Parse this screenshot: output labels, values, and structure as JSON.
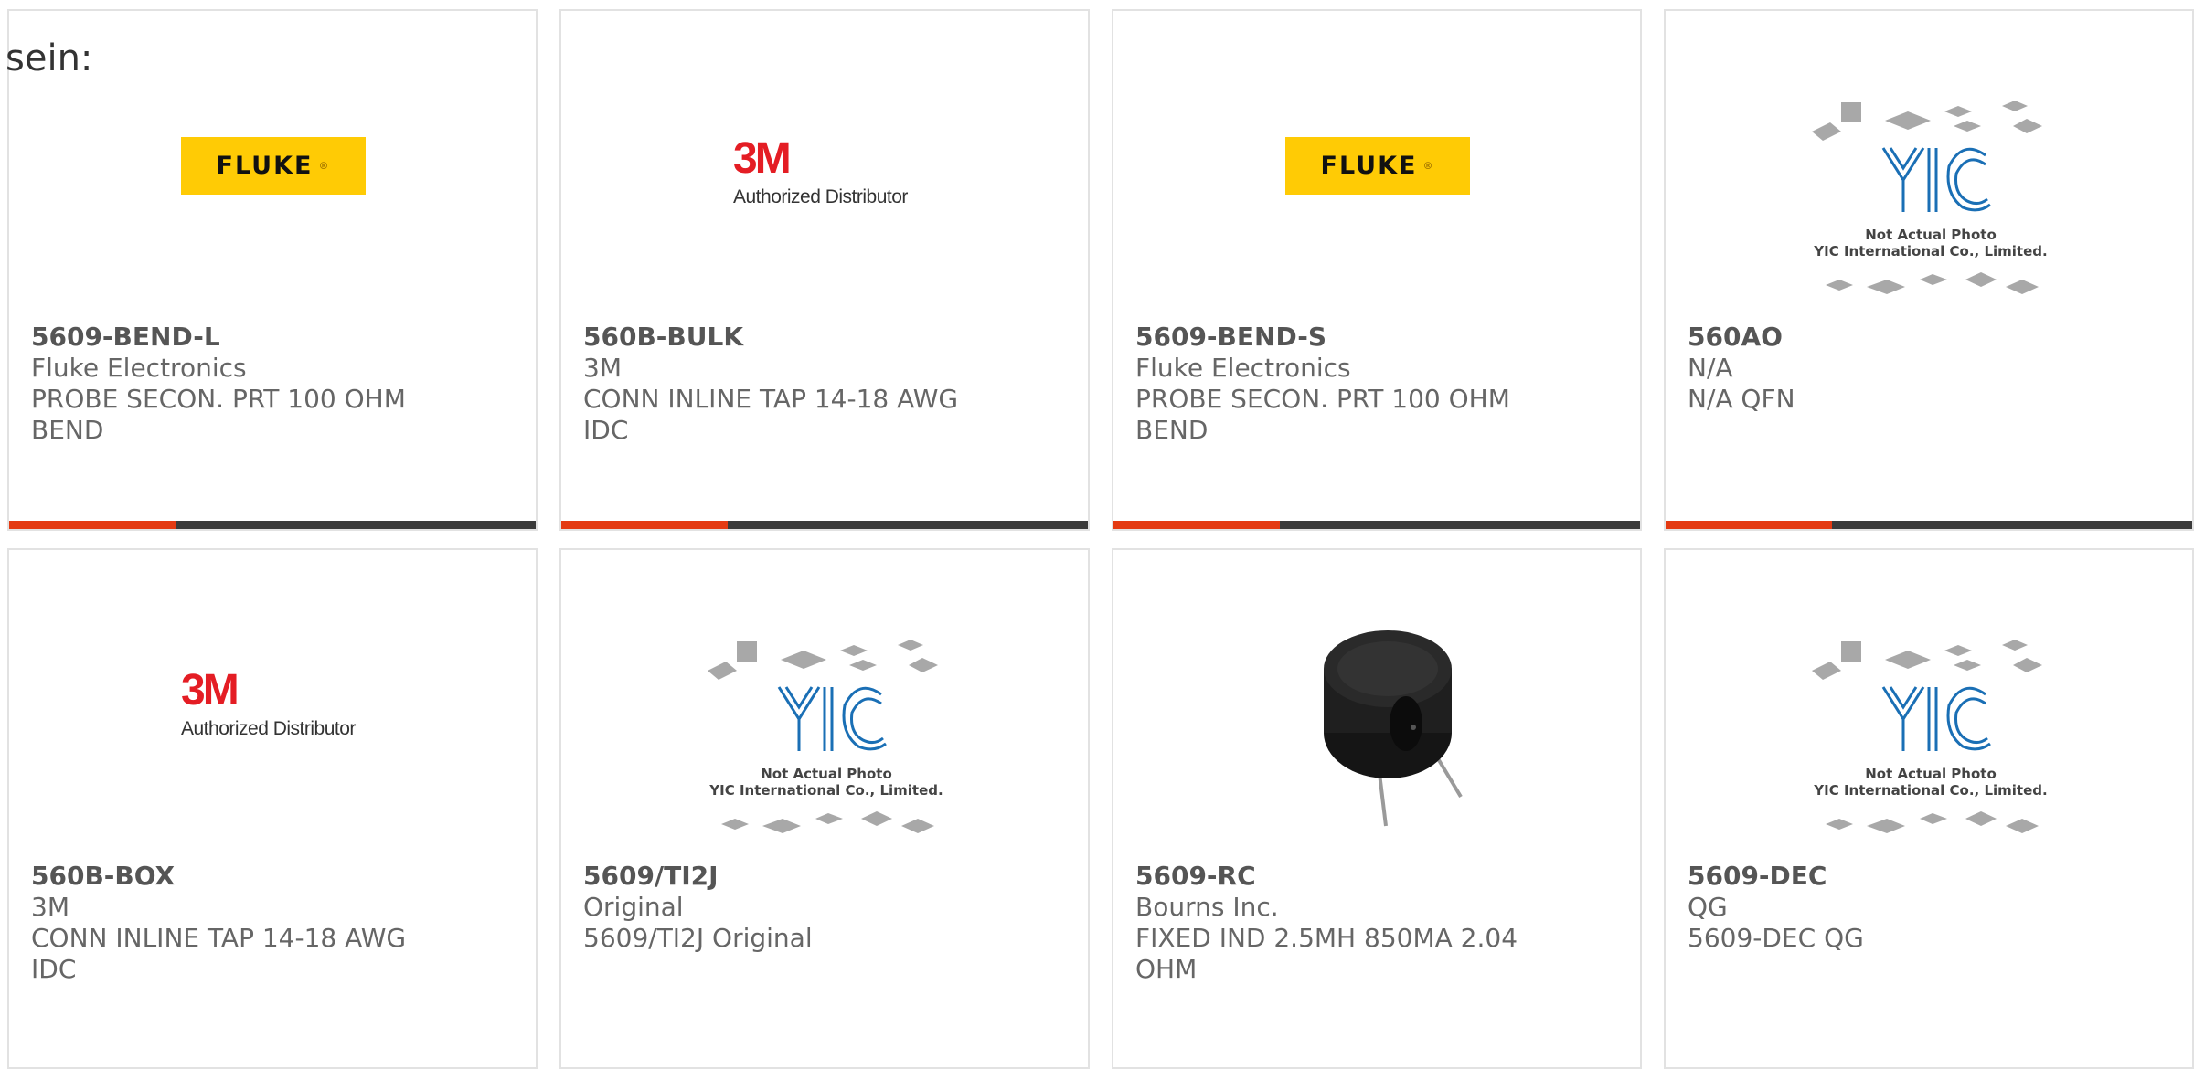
{
  "intro_text": "sein:",
  "products": [
    {
      "logo": "fluke",
      "logo_text": "FLUKE",
      "part_number": "5609-BEND-L",
      "manufacturer": "Fluke Electronics",
      "description": "PROBE SECON. PRT 100 OHM BEND"
    },
    {
      "logo": "3m",
      "logo_text": "3M",
      "logo_subtext": "Authorized Distributor",
      "part_number": "560B-BULK",
      "manufacturer": "3M",
      "description": "CONN INLINE TAP 14-18 AWG IDC"
    },
    {
      "logo": "fluke",
      "logo_text": "FLUKE",
      "part_number": "5609-BEND-S",
      "manufacturer": "Fluke Electronics",
      "description": "PROBE SECON. PRT 100 OHM BEND"
    },
    {
      "logo": "yic",
      "logo_text": "YIC",
      "logo_subtext": "Not Actual Photo",
      "logo_subtext2": "YIC International Co., Limited.",
      "part_number": "560AO",
      "manufacturer": "N/A",
      "description": "N/A QFN"
    },
    {
      "logo": "3m",
      "logo_text": "3M",
      "logo_subtext": "Authorized Distributor",
      "part_number": "560B-BOX",
      "manufacturer": "3M",
      "description": "CONN INLINE TAP 14-18 AWG IDC"
    },
    {
      "logo": "yic",
      "logo_text": "YIC",
      "logo_subtext": "Not Actual Photo",
      "logo_subtext2": "YIC International Co., Limited.",
      "part_number": "5609/TI2J",
      "manufacturer": "Original",
      "description": "5609/TI2J Original"
    },
    {
      "logo": "inductor",
      "part_number": "5609-RC",
      "manufacturer": "Bourns Inc.",
      "description": "FIXED IND 2.5MH 850MA 2.04 OHM"
    },
    {
      "logo": "yic",
      "logo_text": "YIC",
      "logo_subtext": "Not Actual Photo",
      "logo_subtext2": "YIC International Co., Limited.",
      "part_number": "5609-DEC",
      "manufacturer": "QG",
      "description": "5609-DEC QG"
    }
  ],
  "colors": {
    "accent_red": "#e43a12",
    "bar_dark": "#3a3a3a",
    "fluke_yellow": "#ffcb05",
    "brand_3m_red": "#e41d24",
    "yic_blue": "#1a6fb5"
  }
}
